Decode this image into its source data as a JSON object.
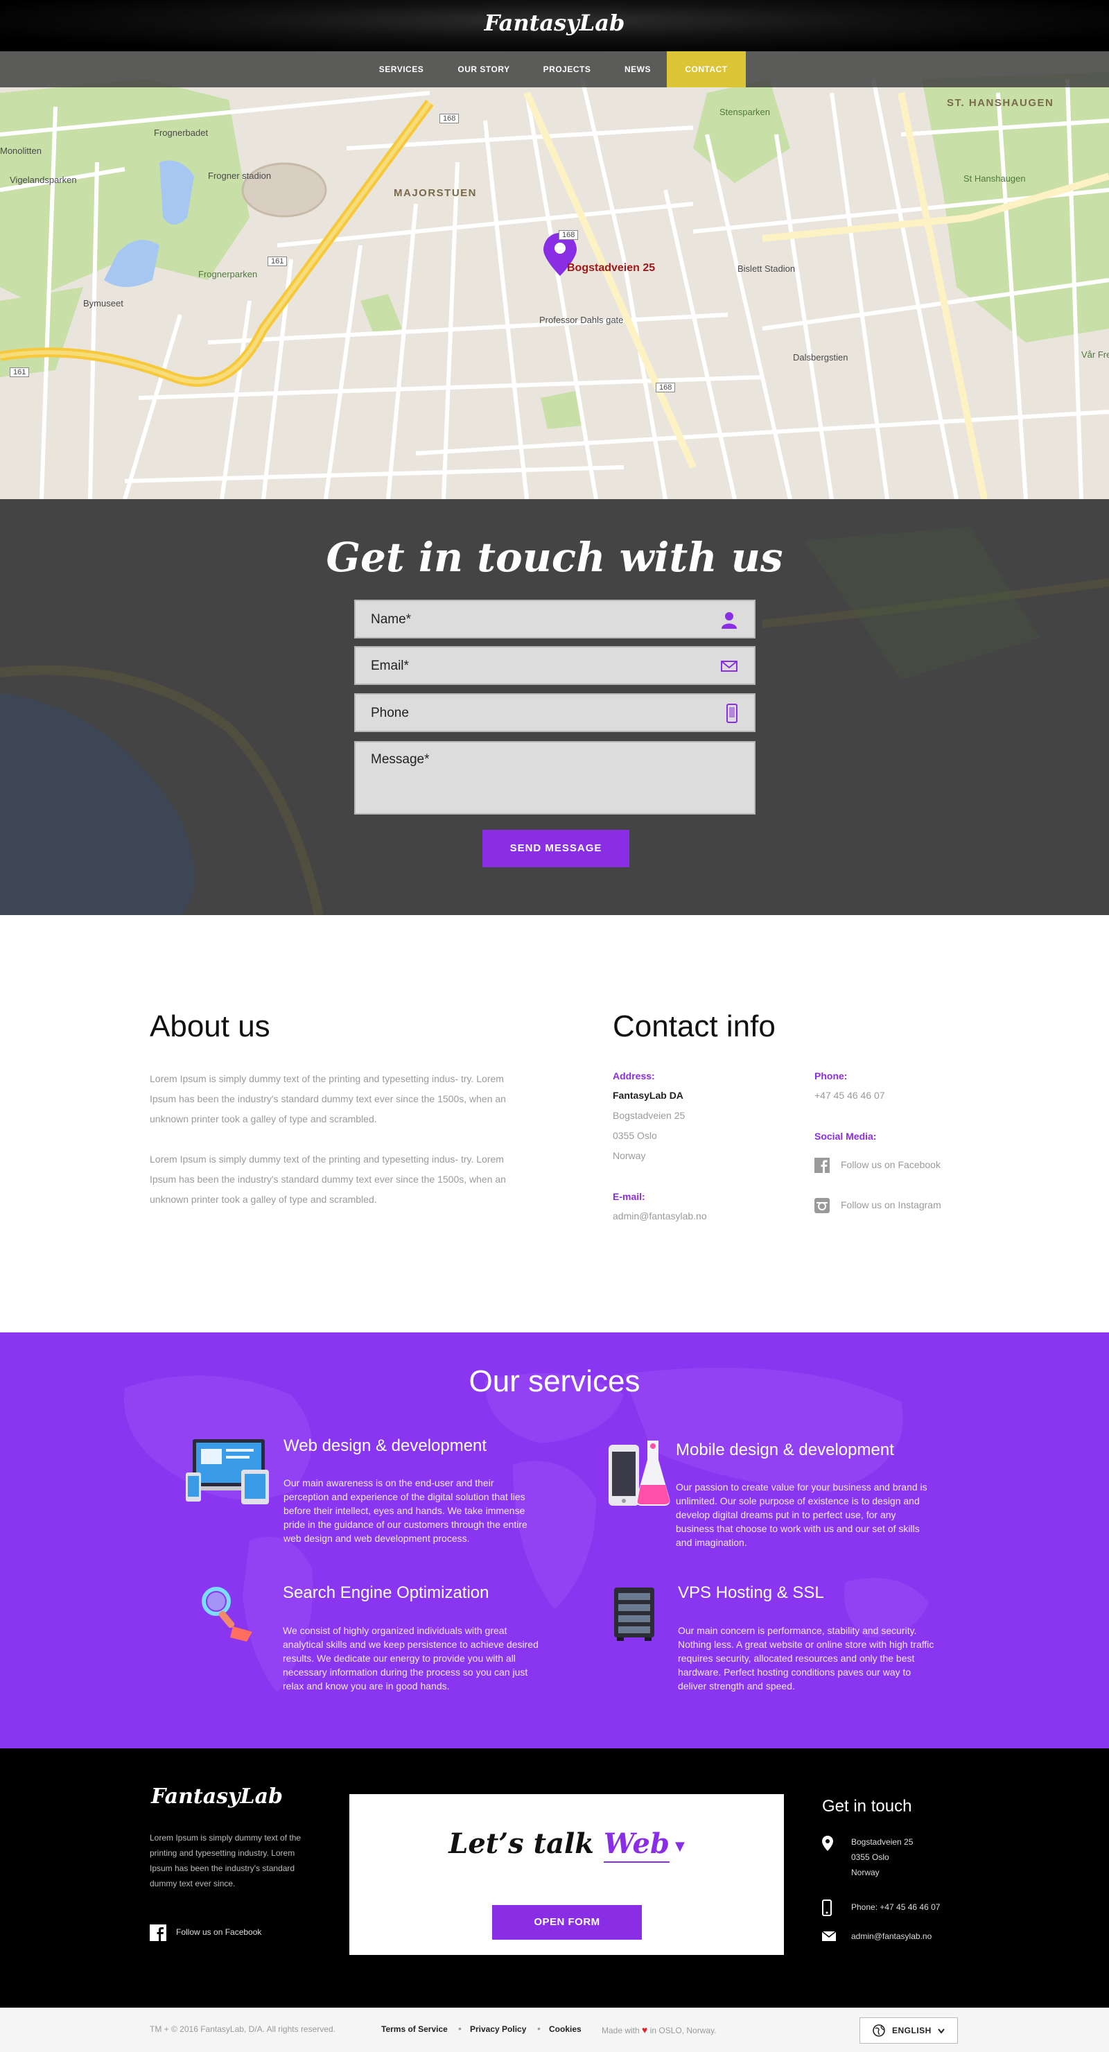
{
  "brand": {
    "logo": "FantasyLab",
    "accent": "#8a2ee6",
    "nav_active_bg": "#dcc437"
  },
  "nav": {
    "items": [
      {
        "label": "SERVICES"
      },
      {
        "label": "OUR STORY"
      },
      {
        "label": "PROJECTS"
      },
      {
        "label": "NEWS"
      },
      {
        "label": "CONTACT",
        "active": true
      }
    ]
  },
  "map": {
    "pin_label": "Bogstadveien 25",
    "labels": {
      "majorstuen": "MAJORSTUEN",
      "st_hanshaugen": "ST. HANSHAUGEN",
      "st_hanshaugen_park": "St Hanshaugen",
      "frognerbadet": "Frognerbadet",
      "frogner_stadion": "Frogner stadion",
      "vigelandsparken": "Vigelandsparken",
      "frognerparken": "Frognerparken",
      "bymuseet": "Bymuseet",
      "bislett": "Bislett Stadion",
      "prof_dahls": "Professor Dahls gate",
      "dalsbergstien": "Dalsbergstien",
      "stensparken": "Stensparken",
      "monolitten": "Monolitten",
      "var_frelser": "Vår Frel",
      "r168": "168",
      "r161": "161"
    }
  },
  "contact_form": {
    "title": "Get in touch with us",
    "name_placeholder": "Name*",
    "email_placeholder": "Email*",
    "phone_placeholder": "Phone",
    "message_placeholder": "Message*",
    "submit_label": "SEND MESSAGE"
  },
  "about": {
    "title": "About us",
    "paragraphs": [
      "Lorem Ipsum is simply dummy text of the printing and typesetting indus- try. Lorem Ipsum has been the industry's standard dummy text ever since the 1500s, when an unknown printer took a galley of type and scrambled.",
      "Lorem Ipsum is simply dummy text of the printing and typesetting indus- try. Lorem Ipsum has been the industry's standard dummy text ever since the 1500s, when an unknown printer took a galley of type and scrambled."
    ]
  },
  "contact_info": {
    "title": "Contact info",
    "address_label": "Address:",
    "company": "FantasyLab DA",
    "street": "Bogstadveien 25",
    "postal": "0355 Oslo",
    "country": "Norway",
    "email_label": "E-mail:",
    "email": "admin@fantasylab.no",
    "phone_label": "Phone:",
    "phone": "+47 45 46 46 07",
    "social_label": "Social Media:",
    "facebook": "Follow us on Facebook",
    "instagram": "Follow us on Instagram"
  },
  "services": {
    "title": "Our services",
    "items": [
      {
        "title": "Web design & development",
        "icon": "web-design-icon",
        "text": "Our main awareness is on the end-user and their perception and experience of the digital solution that lies before their intellect, eyes and hands. We take immense pride in the guidance of our customers through the entire web design and web development process."
      },
      {
        "title": "Mobile design & development",
        "icon": "mobile-lab-icon",
        "text": "Our passion to create value for your business and brand is unlimited. Our sole purpose of existence is to design and develop digital dreams put in to perfect use, for any business that choose to work with us and our set of skills and imagination."
      },
      {
        "title": "Search Engine Optimization",
        "icon": "magnifier-icon",
        "text": "We consist of highly organized individuals with great analytical skills and we keep persistence to achieve desired results. We dedicate our energy to provide you with all necessary information during the process so you can just relax and know you are in good hands."
      },
      {
        "title": "VPS Hosting & SSL",
        "icon": "server-icon",
        "text": "Our main concern is performance, stability and security. Nothing less. A great website or online store with high traffic requires security, allocated resources and only the best hardware. Perfect hosting conditions paves our way to deliver strength and speed."
      }
    ]
  },
  "footer": {
    "logo": "FantasyLab",
    "text": "Lorem Ipsum is simply dummy text of the printing and typesetting industry. Lorem Ipsum has been the industry's standard dummy text ever since.",
    "facebook": "Follow us on Facebook",
    "talk_prefix": "Let’s talk",
    "talk_word": "Web",
    "open_form": "OPEN FORM",
    "git_title": "Get in touch",
    "address_lines": [
      "Bogstadveien 25",
      "0355 Oslo",
      "Norway"
    ],
    "phone": "Phone: +47 45 46 46 07",
    "email": "admin@fantasylab.no"
  },
  "bottom": {
    "copyright": "TM + © 2016 FantasyLab, D/A. All rights reserved.",
    "terms": "Terms of Service",
    "privacy": "Privacy Policy",
    "cookies": "Cookies",
    "made_with_prefix": "Made with",
    "made_with_suffix": "in OSLO, Norway.",
    "language": "ENGLISH"
  }
}
